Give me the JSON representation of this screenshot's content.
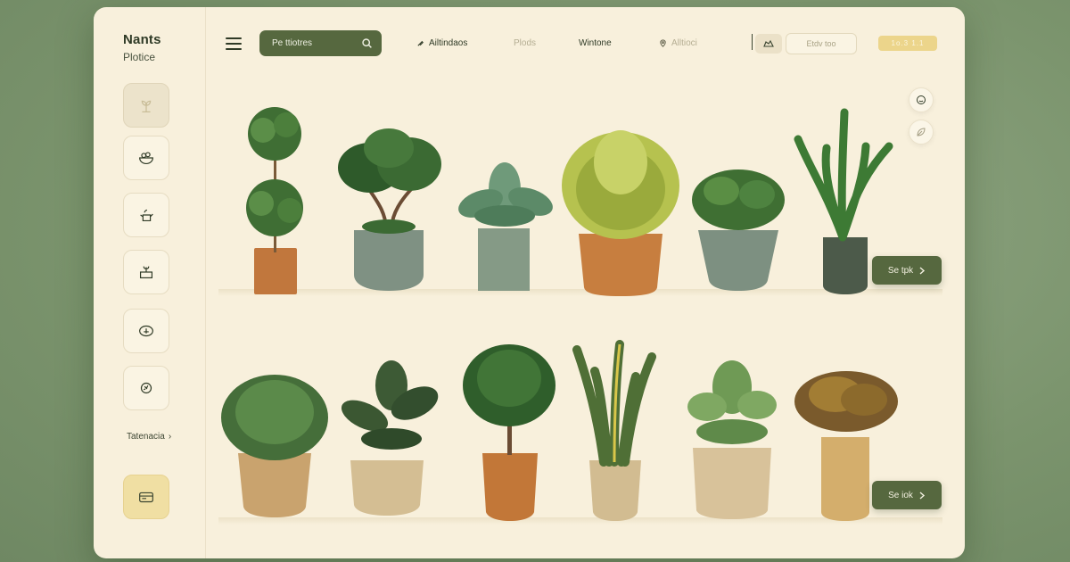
{
  "brand": {
    "title": "Nants",
    "subtitle": "Plotice"
  },
  "sidebar": {
    "link_label": "Tatenacia"
  },
  "header": {
    "search_label": "Pe ttiotres",
    "nav": [
      "Ailtindaos",
      "Plods",
      "Wintone",
      "Alltioci"
    ],
    "pill_outline": "Etdv too",
    "pill_yellow": "1o.3 1.1"
  },
  "rows": [
    {
      "button_label": "Se tpk"
    },
    {
      "button_label": "Se iok"
    }
  ],
  "colors": {
    "accent_green": "#56683f",
    "cream": "#f8f0dc",
    "highlight_yellow": "#ecd58b",
    "backdrop_green": "#7f9a70"
  },
  "icons": {
    "sidebar": [
      "plant-sprout-icon",
      "salad-bowl-icon",
      "watering-can-icon",
      "plant-box-icon",
      "pot-icon",
      "globe-plant-icon",
      "shop-card-icon"
    ],
    "header": [
      "menu-icon",
      "search-icon",
      "pin-icon",
      "chat-icon"
    ]
  }
}
